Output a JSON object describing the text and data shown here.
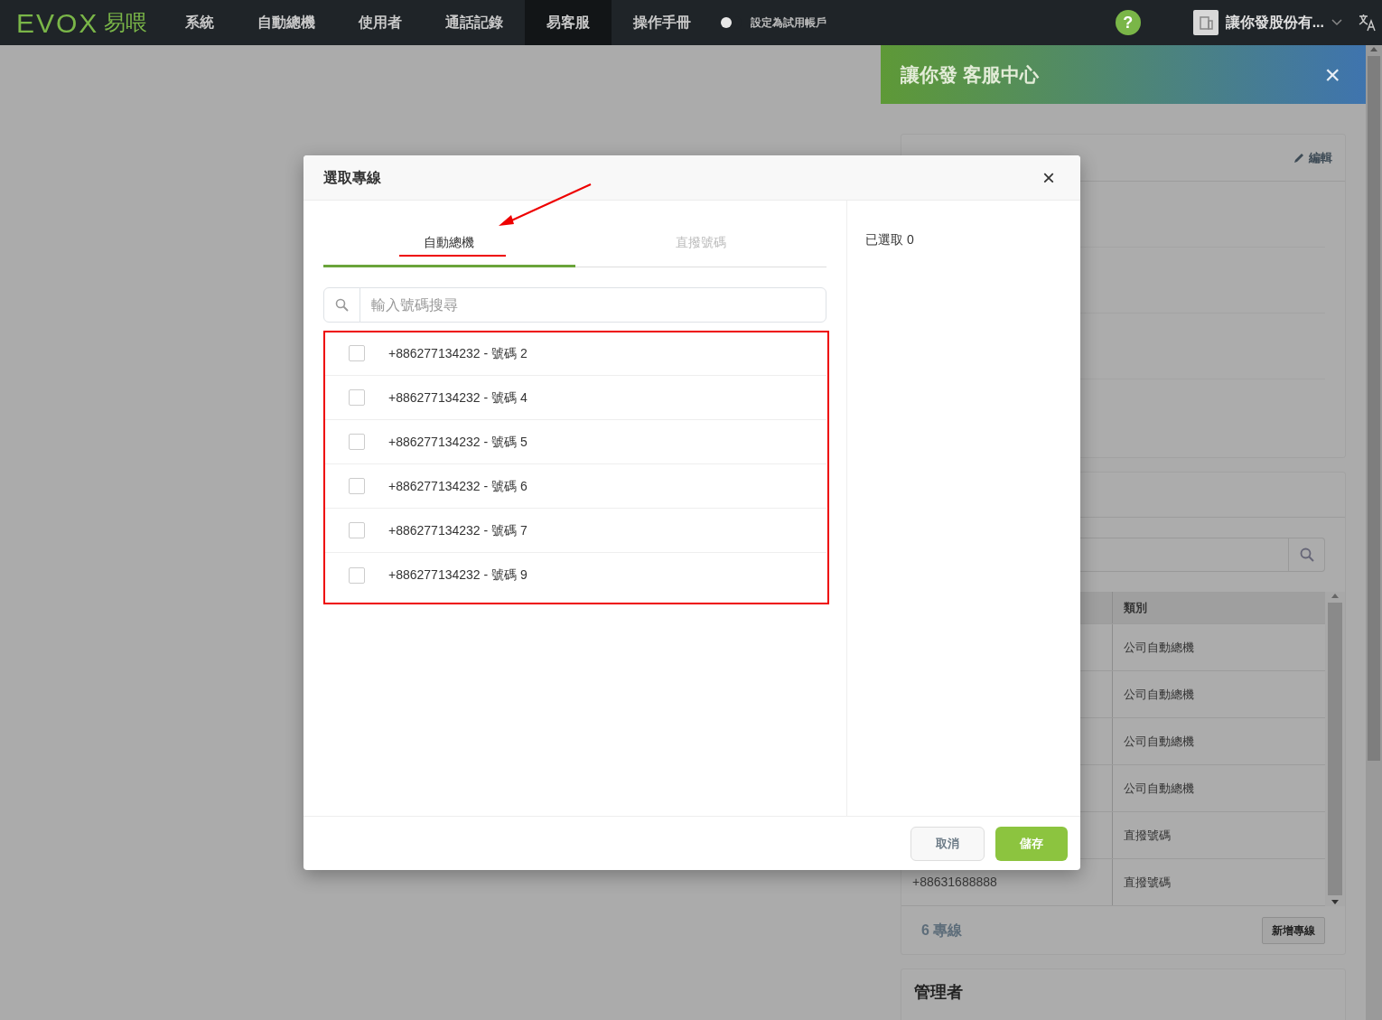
{
  "navbar": {
    "logo": "EVOX",
    "logo_suffix": "易喂",
    "items": [
      {
        "label": "系統",
        "selected": false
      },
      {
        "label": "自動總機",
        "selected": false
      },
      {
        "label": "使用者",
        "selected": false
      },
      {
        "label": "通話記錄",
        "selected": false
      },
      {
        "label": "易客服",
        "selected": true
      },
      {
        "label": "操作手冊",
        "selected": false
      }
    ],
    "trial_toggle": {
      "label": "設定為試用帳戶",
      "on": false
    },
    "help": "?",
    "account": "讓你發股份有..."
  },
  "panel": {
    "title": "讓你發 客服中心",
    "close": "×",
    "info_card": {
      "edit": "編輯"
    },
    "lines_card": {
      "columns": [
        "類別"
      ],
      "rows": [
        {
          "category": "公司自動總機"
        },
        {
          "category": "公司自動總機"
        },
        {
          "category": "公司自動總機"
        },
        {
          "category": "公司自動總機"
        },
        {
          "category": "直撥號碼"
        },
        {
          "number": "+88631688888",
          "category": "直撥號碼"
        }
      ],
      "count": "6 專線",
      "add_button": "新增專線"
    },
    "admin_card": {
      "title": "管理者"
    }
  },
  "modal": {
    "title": "選取專線",
    "close": "×",
    "tabs": [
      {
        "label": "自動總機",
        "selected": true
      },
      {
        "label": "直撥號碼",
        "selected": false
      }
    ],
    "search": {
      "placeholder": "輸入號碼搜尋"
    },
    "items": [
      {
        "label": "+886277134232 - 號碼 2",
        "checked": false
      },
      {
        "label": "+886277134232 - 號碼 4",
        "checked": false
      },
      {
        "label": "+886277134232 - 號碼 5",
        "checked": false
      },
      {
        "label": "+886277134232 - 號碼 6",
        "checked": false
      },
      {
        "label": "+886277134232 - 號碼 7",
        "checked": false
      },
      {
        "label": "+886277134232 - 號碼 9",
        "checked": false
      }
    ],
    "selected_count": "已選取 0",
    "buttons": [
      {
        "kind": "cancel",
        "label": "取消"
      },
      {
        "kind": "save",
        "label": "儲存"
      }
    ]
  }
}
